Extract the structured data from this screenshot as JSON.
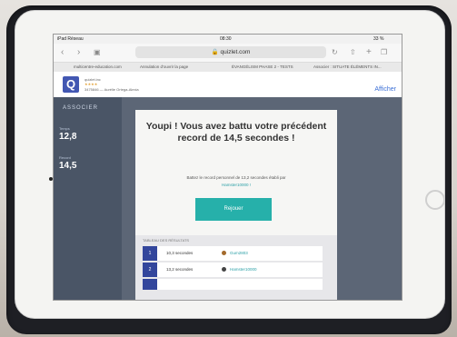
{
  "status": {
    "left": "iPad Réseau",
    "time": "08:30",
    "battery": "33 %"
  },
  "browser": {
    "url": "quizlet.com",
    "reload_icon": "reload-icon",
    "tabs": [
      "Annulation d'ouvrir la page",
      "ÉVANGÉLISM PHASE 2 - TESTS",
      "Associer : SITUATE ÉLÉMENTS IN..."
    ],
    "top_left_tab": "multicentre-education.com"
  },
  "header": {
    "brand": "Q",
    "brand_name": "quizlet.inc",
    "detail": "3475846 — Aurélie Ortega-Alexia",
    "stars": "★★★★",
    "action": "Afficher"
  },
  "sidebar": {
    "title": "ASSOCIER",
    "time_label": "Temps",
    "time_value": "12,8",
    "record_label": "Record",
    "record_value": "14,5"
  },
  "modal": {
    "title": "Youpi ! Vous avez battu votre précédent record de 14,5 secondes !",
    "subtitle": "Battez le record personnel de 13,2 secondes établi par",
    "user": "Hamster10000 !",
    "button": "Rejouer",
    "results_title": "TABLEAU DES RÉSULTATS",
    "results": [
      {
        "rank": "1",
        "time": "10,3 secondes",
        "user": "Gum2803"
      },
      {
        "rank": "2",
        "time": "13,2 secondes",
        "user": "Hamster10000"
      }
    ]
  }
}
